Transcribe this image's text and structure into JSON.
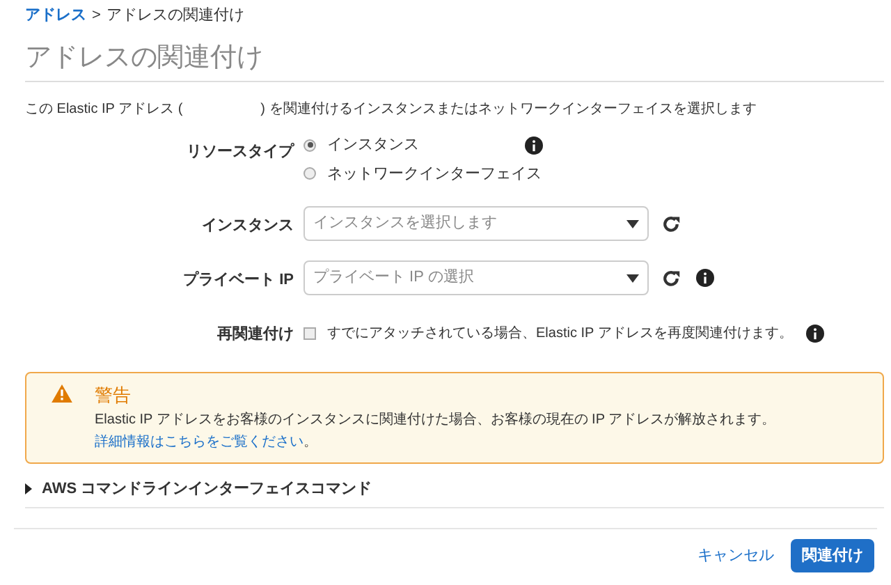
{
  "breadcrumb": [
    {
      "label": "アドレス",
      "kind": "link"
    },
    {
      "label": ">",
      "kind": "separator"
    },
    {
      "label": "アドレスの関連付け",
      "kind": "current"
    }
  ],
  "title": "アドレスの関連付け",
  "description": {
    "before": "この Elastic IP アドレス (",
    "after": ") を関連付けるインスタンスまたはネットワークインターフェイスを選択します"
  },
  "resource_type": {
    "label": "リソースタイプ",
    "options": [
      {
        "label": "インスタンス",
        "selected": true
      },
      {
        "label": "ネットワークインターフェイス",
        "selected": false
      }
    ]
  },
  "instance": {
    "label": "インスタンス",
    "placeholder": "インスタンスを選択します"
  },
  "private_ip": {
    "label": "プライベート IP",
    "placeholder": "プライベート IP の選択"
  },
  "reassociate": {
    "label": "再関連付け",
    "text": "すでにアタッチされている場合、Elastic IP アドレスを再度関連付けます。",
    "checked": false
  },
  "warning": {
    "title": "警告",
    "text": "Elastic IP アドレスをお客様のインスタンスに関連付けた場合、お客様の現在の IP アドレスが解放されます。",
    "link": "詳細情報はこちらをご覧ください",
    "end": "。"
  },
  "cli_section": {
    "label": "AWS コマンドラインインターフェイスコマンド",
    "expanded": false
  },
  "buttons": {
    "cancel": "キャンセル",
    "submit": "関連付け"
  }
}
